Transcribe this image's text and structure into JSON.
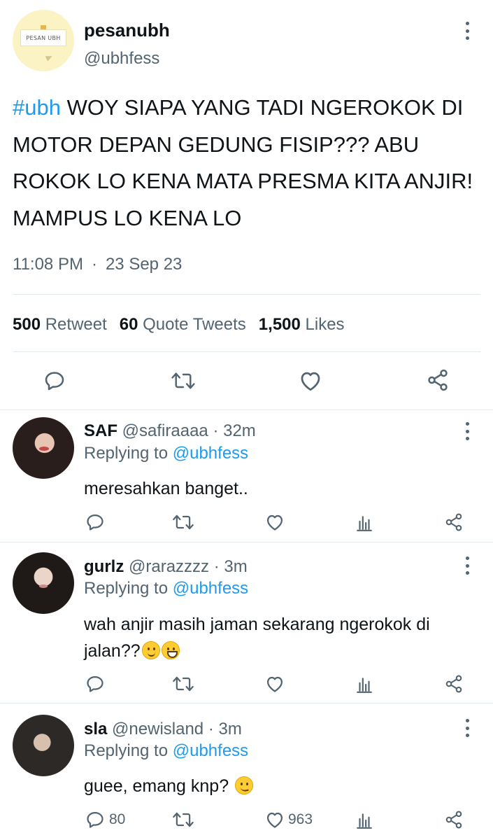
{
  "main_tweet": {
    "avatar_text": "PESAN UBH",
    "display_name": "pesanubh",
    "handle": "@ubhfess",
    "hashtag": "#ubh",
    "text": " WOY SIAPA YANG TADI NGEROKOK DI MOTOR DEPAN GEDUNG FISIP??? ABU ROKOK LO KENA MATA PRESMA KITA ANJIR! MAMPUS LO KENA LO",
    "time": "11:08 PM",
    "separator": "·",
    "date": "23 Sep 23",
    "stats": {
      "retweets_count": "500",
      "retweets_label": "Retweet",
      "quotes_count": "60",
      "quotes_label": "Quote Tweets",
      "likes_count": "1,500",
      "likes_label": "Likes"
    },
    "actions": [
      "reply-icon",
      "retweet-icon",
      "like-icon",
      "share-icon"
    ]
  },
  "replies": [
    {
      "display_name": "SAF",
      "handle": "@safiraaaa",
      "time_ago": "· 32m",
      "replying_label": "Replying to ",
      "replying_to": "@ubhfess",
      "text": "meresahkan banget..",
      "reply_count": "",
      "like_count": ""
    },
    {
      "display_name": "gurlz",
      "handle": "@rarazzzz",
      "time_ago": "· 3m",
      "replying_label": "Replying to ",
      "replying_to": "@ubhfess",
      "text": "wah anjir masih jaman sekarang ngerokok di jalan??",
      "emojis": [
        "slightly-smiling-face",
        "grinning-face"
      ],
      "reply_count": "",
      "like_count": ""
    },
    {
      "display_name": "sla",
      "handle": "@newisland",
      "time_ago": "· 3m",
      "replying_label": "Replying to ",
      "replying_to": "@ubhfess",
      "text": "guee, emang knp?",
      "emojis": [
        "woozy-face"
      ],
      "reply_count": "80",
      "like_count": "963"
    }
  ],
  "colors": {
    "text": "#0f1419",
    "secondary": "#536471",
    "accent": "#1d9bf0",
    "divider": "#e1e8ed"
  }
}
